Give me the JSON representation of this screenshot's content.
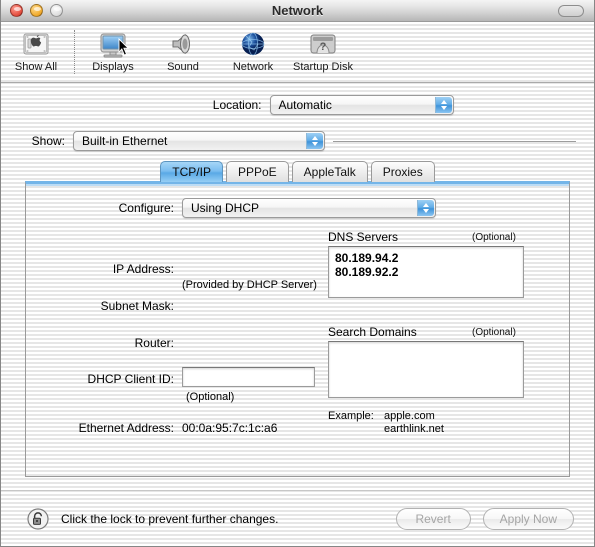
{
  "window": {
    "title": "Network",
    "traffic_lights": [
      "close",
      "minimize",
      "zoom"
    ],
    "toolbar_toggle": "toolbar-toggle-pill"
  },
  "toolbar": {
    "items": [
      {
        "label": "Show All",
        "icon": "show-all-icon"
      },
      {
        "label": "Displays",
        "icon": "displays-icon"
      },
      {
        "label": "Sound",
        "icon": "sound-icon"
      },
      {
        "label": "Network",
        "icon": "network-globe-icon"
      },
      {
        "label": "Startup Disk",
        "icon": "startup-disk-icon"
      }
    ]
  },
  "location": {
    "label": "Location:",
    "value": "Automatic"
  },
  "show": {
    "label": "Show:",
    "value": "Built-in Ethernet"
  },
  "tabs": [
    {
      "label": "TCP/IP",
      "active": true
    },
    {
      "label": "PPPoE",
      "active": false
    },
    {
      "label": "AppleTalk",
      "active": false
    },
    {
      "label": "Proxies",
      "active": false
    }
  ],
  "tcpip": {
    "configure_label": "Configure:",
    "configure_value": "Using DHCP",
    "ip_address_label": "IP Address:",
    "ip_address_value": "",
    "ip_address_note": "(Provided by DHCP Server)",
    "subnet_mask_label": "Subnet Mask:",
    "subnet_mask_value": "",
    "router_label": "Router:",
    "router_value": "",
    "dhcp_client_id_label": "DHCP Client ID:",
    "dhcp_client_id_value": "",
    "dhcp_client_id_note": "(Optional)",
    "ethernet_address_label": "Ethernet Address:",
    "ethernet_address_value": "00:0a:95:7c:1c:a6",
    "dns_servers_title": "DNS Servers",
    "dns_servers_optional": "(Optional)",
    "dns_servers_value": "80.189.94.2\n80.189.92.2",
    "search_domains_title": "Search Domains",
    "search_domains_optional": "(Optional)",
    "search_domains_value": "",
    "example_label": "Example:",
    "example_value": "apple.com\nearthlink.net"
  },
  "footer": {
    "lock_icon": "open-padlock-icon",
    "lock_text": "Click the lock to prevent further changes.",
    "revert_label": "Revert",
    "apply_label": "Apply Now"
  },
  "colors": {
    "accent_blue": "#5aa9e6",
    "panel_border": "#9a9a9a",
    "tab_top_rule": "#74b5e8"
  }
}
